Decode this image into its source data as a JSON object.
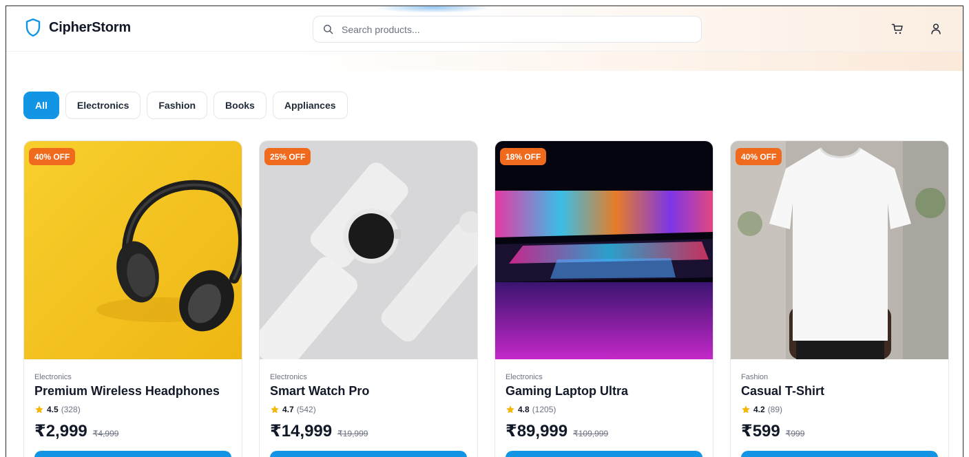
{
  "brand": {
    "name": "CipherStorm"
  },
  "search": {
    "placeholder": "Search products..."
  },
  "header": {
    "cart_icon": "cart-icon",
    "user_icon": "user-icon"
  },
  "categories": [
    {
      "label": "All",
      "active": true
    },
    {
      "label": "Electronics",
      "active": false
    },
    {
      "label": "Fashion",
      "active": false
    },
    {
      "label": "Books",
      "active": false
    },
    {
      "label": "Appliances",
      "active": false
    }
  ],
  "colors": {
    "accent": "#1195e4",
    "discount_badge": "#f06a1d",
    "star": "#f5b60a"
  },
  "products": [
    {
      "badge": "40% OFF",
      "category": "Electronics",
      "name": "Premium Wireless Headphones",
      "rating": "4.5",
      "reviews": "(328)",
      "price": "₹2,999",
      "mrp": "₹4,999"
    },
    {
      "badge": "25% OFF",
      "category": "Electronics",
      "name": "Smart Watch Pro",
      "rating": "4.7",
      "reviews": "(542)",
      "price": "₹14,999",
      "mrp": "₹19,999"
    },
    {
      "badge": "18% OFF",
      "category": "Electronics",
      "name": "Gaming Laptop Ultra",
      "rating": "4.8",
      "reviews": "(1205)",
      "price": "₹89,999",
      "mrp": "₹109,999"
    },
    {
      "badge": "40% OFF",
      "category": "Fashion",
      "name": "Casual T-Shirt",
      "rating": "4.2",
      "reviews": "(89)",
      "price": "₹599",
      "mrp": "₹999"
    }
  ]
}
